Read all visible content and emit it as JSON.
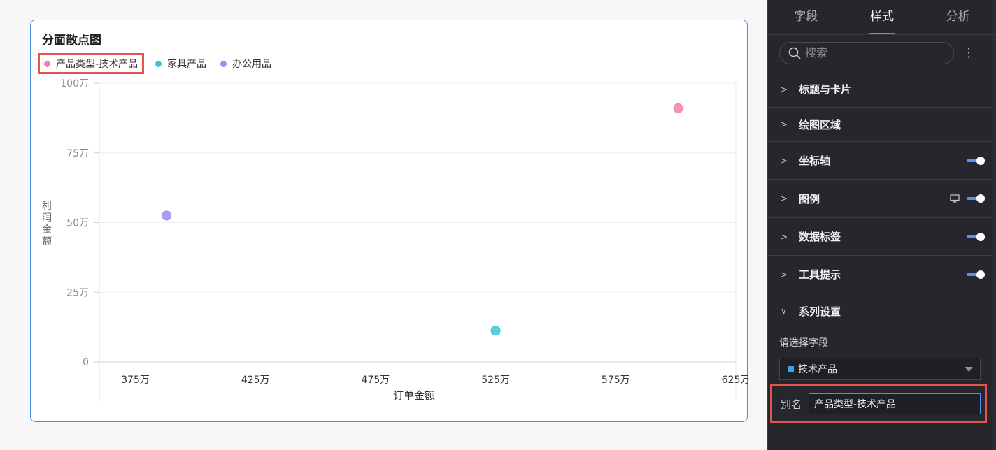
{
  "chart_card": {
    "title": "分面散点图"
  },
  "chart_data": {
    "type": "scatter",
    "xlabel": "订单金额",
    "ylabel": "利润金额",
    "xlim": [
      3600000,
      6250000
    ],
    "ylim": [
      0,
      1000000
    ],
    "x_ticks": [
      {
        "value": 3750000,
        "label": "375万"
      },
      {
        "value": 4250000,
        "label": "425万"
      },
      {
        "value": 4750000,
        "label": "475万"
      },
      {
        "value": 5250000,
        "label": "525万"
      },
      {
        "value": 5750000,
        "label": "575万"
      },
      {
        "value": 6250000,
        "label": "625万"
      }
    ],
    "y_ticks": [
      {
        "value": 0,
        "label": "0"
      },
      {
        "value": 250000,
        "label": "25万"
      },
      {
        "value": 500000,
        "label": "50万"
      },
      {
        "value": 750000,
        "label": "75万"
      },
      {
        "value": 1000000,
        "label": "100万"
      }
    ],
    "grid": true,
    "legend_position": "top-left",
    "series": [
      {
        "name": "产品类型-技术产品",
        "color": "#f47fa9",
        "points": [
          {
            "x": 6010000,
            "y": 910000
          }
        ]
      },
      {
        "name": "家具产品",
        "color": "#3fc4d6",
        "points": [
          {
            "x": 5250000,
            "y": 112000
          }
        ]
      },
      {
        "name": "办公用品",
        "color": "#9b8ef0",
        "points": [
          {
            "x": 3880000,
            "y": 525000
          }
        ]
      }
    ]
  },
  "panel": {
    "tabs": [
      {
        "label": "字段",
        "active": false
      },
      {
        "label": "样式",
        "active": true
      },
      {
        "label": "分析",
        "active": false
      }
    ],
    "search_placeholder": "搜索",
    "sections": [
      {
        "label": "标题与卡片",
        "toggle": false,
        "monitor": false
      },
      {
        "label": "绘图区域",
        "toggle": false,
        "monitor": false
      },
      {
        "label": "坐标轴",
        "toggle": true,
        "monitor": false
      },
      {
        "label": "图例",
        "toggle": true,
        "monitor": true
      },
      {
        "label": "数据标签",
        "toggle": true,
        "monitor": false
      },
      {
        "label": "工具提示",
        "toggle": true,
        "monitor": false
      }
    ],
    "series_section": {
      "label": "系列设置",
      "field_label": "请选择字段",
      "selected_field": "技术产品",
      "alias_label": "别名",
      "alias_value": "产品类型-技术产品"
    }
  },
  "colors": {
    "accent": "#4e8cff",
    "highlight_border": "#e5534b"
  }
}
